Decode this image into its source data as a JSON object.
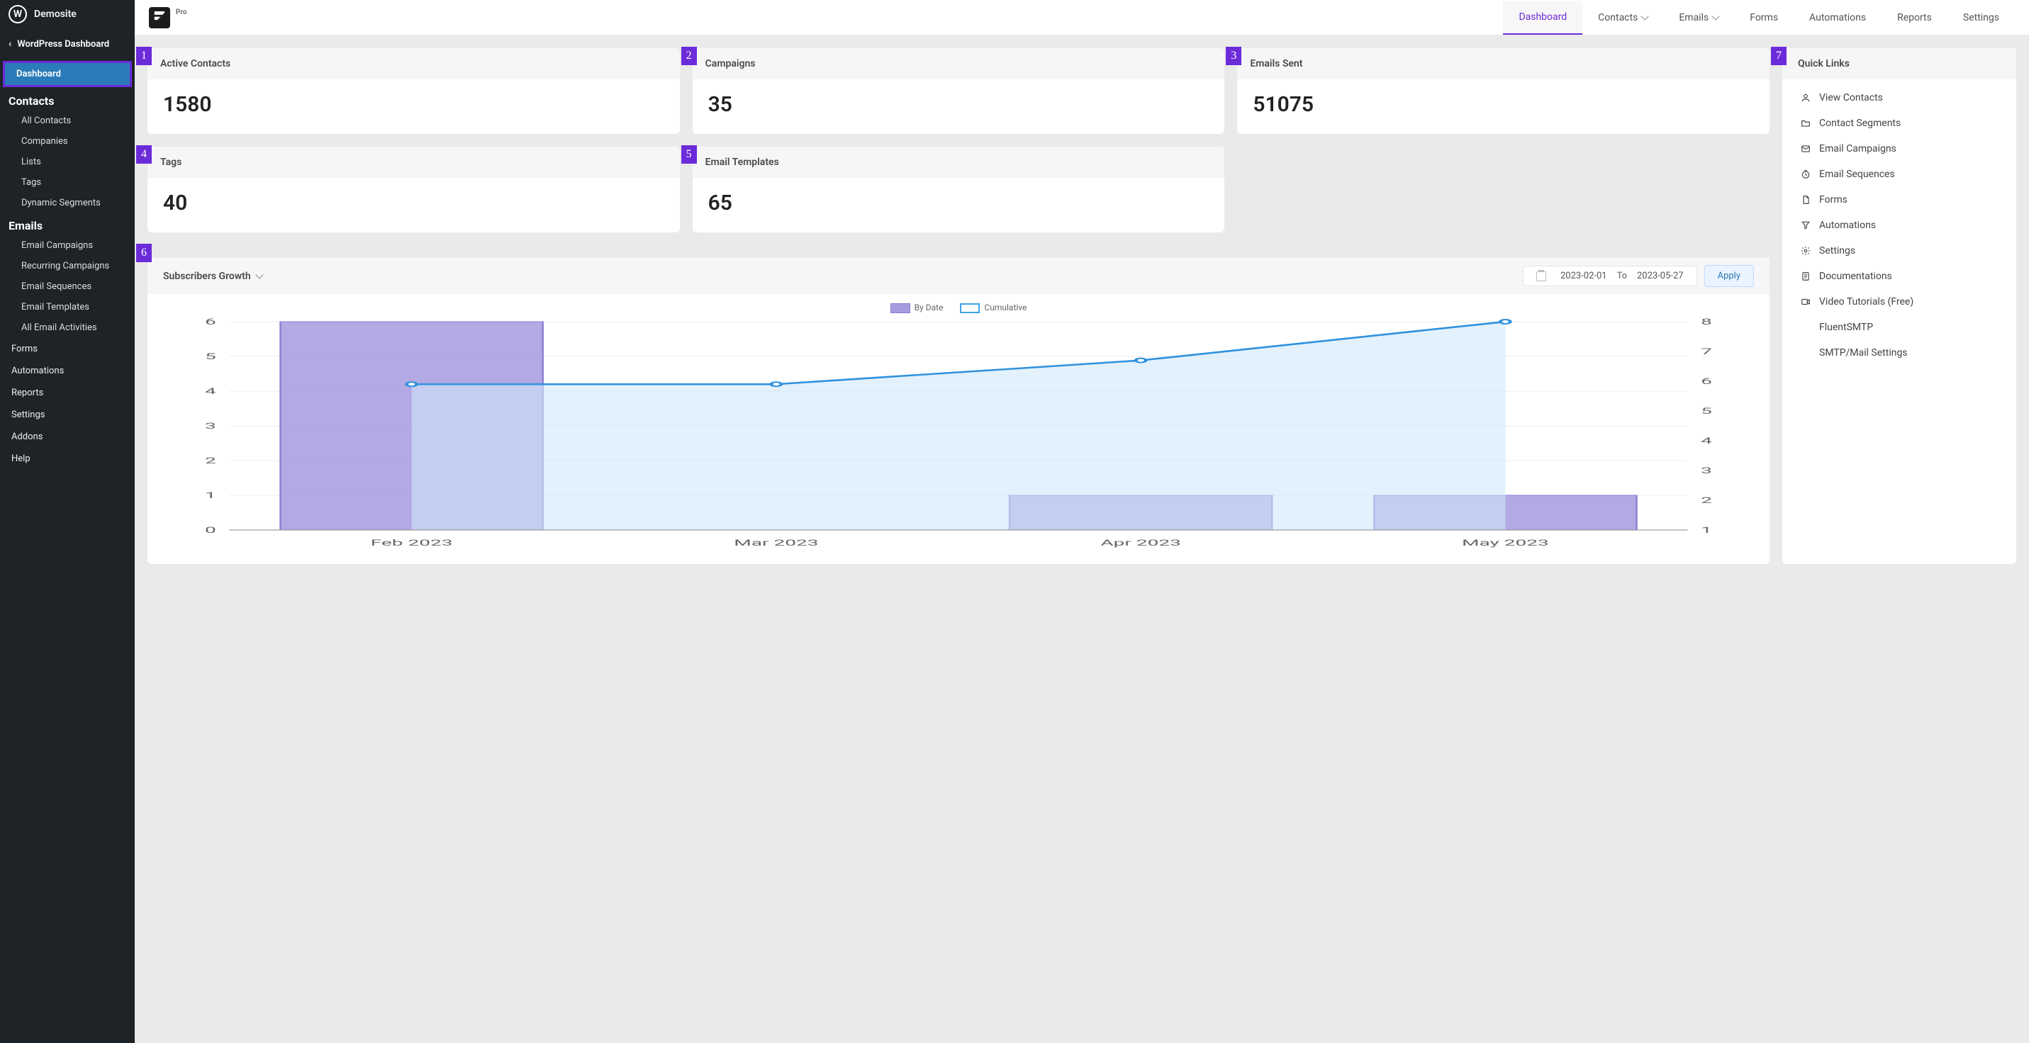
{
  "wp": {
    "site_name": "Demosite",
    "back_label": "WordPress Dashboard",
    "dashboard": "Dashboard",
    "sections": {
      "contacts": {
        "title": "Contacts",
        "items": [
          "All Contacts",
          "Companies",
          "Lists",
          "Tags",
          "Dynamic Segments"
        ]
      },
      "emails": {
        "title": "Emails",
        "items": [
          "Email Campaigns",
          "Recurring Campaigns",
          "Email Sequences",
          "Email Templates",
          "All Email Activities"
        ]
      }
    },
    "footer_items": [
      "Forms",
      "Automations",
      "Reports",
      "Settings",
      "Addons",
      "Help"
    ]
  },
  "brand_pro": "Pro",
  "topnav": {
    "dashboard": "Dashboard",
    "contacts": "Contacts",
    "emails": "Emails",
    "forms": "Forms",
    "automations": "Automations",
    "reports": "Reports",
    "settings": "Settings"
  },
  "stats": {
    "active_contacts": {
      "label": "Active Contacts",
      "value": "1580"
    },
    "campaigns": {
      "label": "Campaigns",
      "value": "35"
    },
    "emails_sent": {
      "label": "Emails Sent",
      "value": "51075"
    },
    "tags": {
      "label": "Tags",
      "value": "40"
    },
    "email_templates": {
      "label": "Email Templates",
      "value": "65"
    }
  },
  "badges": {
    "b1": "1",
    "b2": "2",
    "b3": "3",
    "b4": "4",
    "b5": "5",
    "b6": "6",
    "b7": "7"
  },
  "chart": {
    "title": "Subscribers Growth",
    "date_from": "2023-02-01",
    "date_sep": "To",
    "date_to": "2023-05-27",
    "apply": "Apply",
    "legend_bydate": "By Date",
    "legend_cumulative": "Cumulative"
  },
  "quick_links": {
    "title": "Quick Links",
    "items": [
      "View Contacts",
      "Contact Segments",
      "Email Campaigns",
      "Email Sequences",
      "Forms",
      "Automations",
      "Settings",
      "Documentations",
      "Video Tutorials (Free)",
      "FluentSMTP",
      "SMTP/Mail Settings"
    ]
  },
  "chart_data": {
    "type": "bar+line",
    "categories": [
      "Feb 2023",
      "Mar 2023",
      "Apr 2023",
      "May 2023"
    ],
    "series": [
      {
        "name": "By Date",
        "type": "bar",
        "axis": "left",
        "values": [
          6,
          0,
          1,
          1
        ]
      },
      {
        "name": "Cumulative",
        "type": "line",
        "axis": "right",
        "values": [
          5.9,
          5.9,
          6.7,
          8
        ]
      }
    ],
    "left_ylim": [
      0,
      6
    ],
    "right_ylim": [
      1,
      8
    ],
    "left_ticks": [
      0,
      1,
      2,
      3,
      4,
      5,
      6
    ],
    "right_ticks": [
      1,
      2,
      3,
      4,
      5,
      6,
      7,
      8
    ]
  }
}
